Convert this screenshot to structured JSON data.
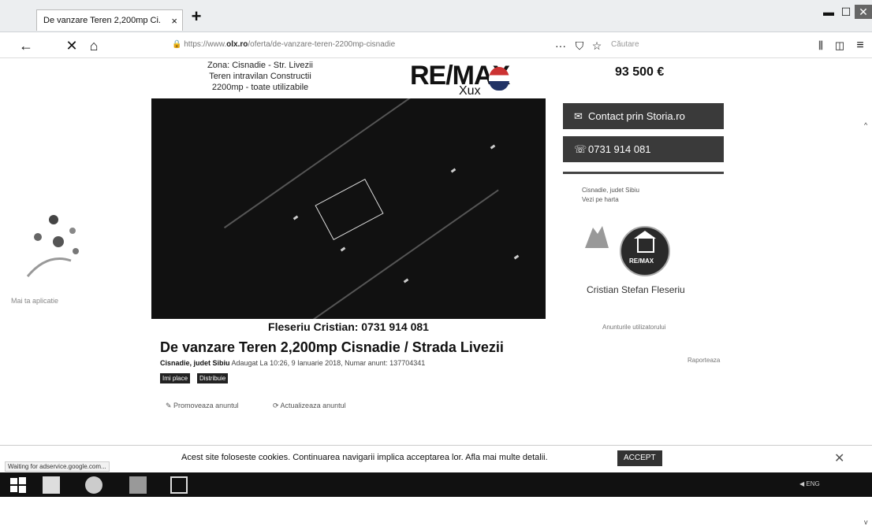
{
  "browser": {
    "tab_title": "De vanzare Teren 2,200mp Ci.",
    "tab_close": "×",
    "new_tab": "+",
    "url_prefix": "https://www.",
    "url_domain": "olx.ro",
    "url_rest": "/oferta/de-vanzare-teren-2200mp-cisnadie",
    "search_placeholder": "Căutare",
    "more": "···"
  },
  "banner": {
    "line1": "Zona: Cisnadie - Str. Livezii",
    "line2": "Teren intravilan Constructii",
    "line3": "2200mp - toate utilizabile",
    "brand": "RE/MAX",
    "brand_sub": "Xux"
  },
  "listing": {
    "price": "93 500 €",
    "photo_caption": "Fleseriu Cristian: 0731 914 081",
    "title": "De vanzare Teren 2,200mp Cisnadie / Strada Livezii",
    "location": "Cisnadie, judet Sibiu",
    "meta": "Adaugat La 10:26, 9 Ianuarie 2018, Numar anunt: 137704341",
    "badge1": "Imi place",
    "badge2": "Distribuie",
    "action1": "Promoveaza anuntul",
    "action2": "Actualizeaza anuntul"
  },
  "sidebar": {
    "contact_btn": "Contact prin Storia.ro",
    "phone_btn": "0731 914 081",
    "loc_line1": "Cisnadie, judet Sibiu",
    "loc_line2": "Vezi pe harta",
    "agent_name": "Cristian Stefan Fleseriu",
    "all_ads": "Anunturile utilizatorului",
    "stat_right": "Raporteaza"
  },
  "left": {
    "label": "Mai ta aplicatie"
  },
  "cookie": {
    "text": "Acest site foloseste cookies. Continuarea navigarii implica acceptarea lor. Afla mai multe detalii.",
    "accept": "ACCEPT",
    "close": "✕"
  },
  "status": "Waiting for adservice.google.com...",
  "tray": "ENG"
}
